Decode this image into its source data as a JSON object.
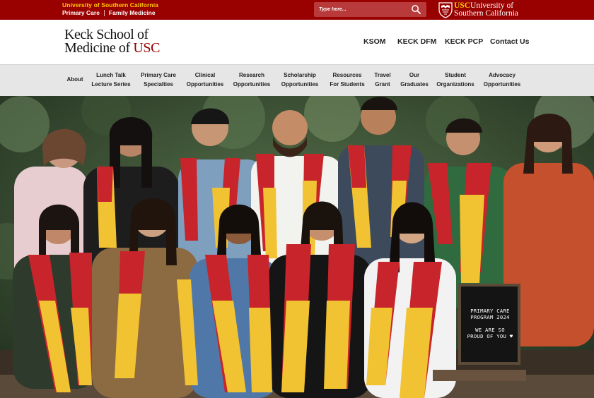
{
  "topbar": {
    "org_name": "University of Southern California",
    "links": [
      "Primary Care",
      "Family Medicine"
    ],
    "search_placeholder": "Type here...",
    "logo_line1_brand": "USC",
    "logo_line1_rest": "University of",
    "logo_line2": "Southern California"
  },
  "header": {
    "brand_line1": "Keck School of",
    "brand_line2_prefix": "Medicine of ",
    "brand_line2_usc": "USC",
    "nav": [
      "KSOM",
      "KECK DFM",
      "KECK PCP",
      "Contact Us"
    ]
  },
  "subnav": {
    "items": [
      {
        "line1": "About",
        "line2": ""
      },
      {
        "line1": "Lunch Talk",
        "line2": "Lecture Series"
      },
      {
        "line1": "Primary Care",
        "line2": "Specialties"
      },
      {
        "line1": "Clinical",
        "line2": "Opportunities"
      },
      {
        "line1": "Research",
        "line2": "Opportunities"
      },
      {
        "line1": "Scholarship",
        "line2": "Opportunities"
      },
      {
        "line1": "Resources",
        "line2": "For Students"
      },
      {
        "line1": "Travel",
        "line2": "Grant"
      },
      {
        "line1": "Our",
        "line2": "Graduates"
      },
      {
        "line1": "Student",
        "line2": "Organizations"
      },
      {
        "line1": "Advocacy",
        "line2": "Opportunities"
      }
    ]
  },
  "hero": {
    "board_line1": "PRIMARY CARE",
    "board_line2": "PROGRAM 2024",
    "board_line3": "WE ARE SO",
    "board_line4": "PROUD OF YOU ♥"
  },
  "colors": {
    "usc_cardinal": "#990000",
    "usc_gold": "#ffcc00",
    "subnav_bg": "#e6e6e6",
    "stole_red": "#c8242b",
    "stole_gold": "#f1c232"
  }
}
